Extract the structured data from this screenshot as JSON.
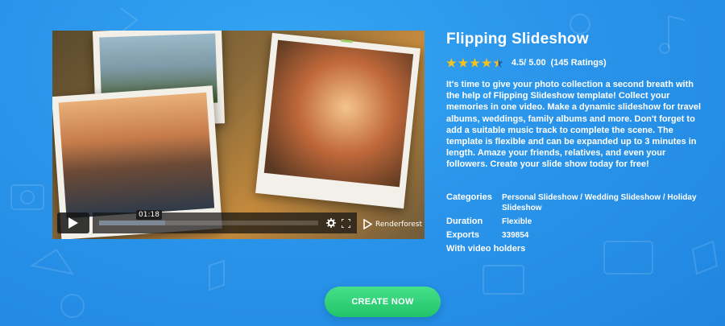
{
  "colors": {
    "accent": "#22c46a",
    "star": "#f7c21b",
    "background": "#2a94ea"
  },
  "player": {
    "current_time": "01:18",
    "progress": 0.3,
    "brand": "Renderforest",
    "icons": [
      "play-icon",
      "settings-icon",
      "fullscreen-icon",
      "renderforest-logo-icon"
    ]
  },
  "template": {
    "title": "Flipping Slideshow",
    "rating": {
      "stars": 4.5,
      "text": "4.5/ 5.00",
      "count": "(145 Ratings)"
    },
    "description": "It's time to give your photo collection a second breath with the help of Flipping Slideshow template! Collect your memories in one video. Make a dynamic slideshow for travel albums, weddings, family albums and more. Don't forget to add a suitable music track to complete the scene. The template is flexible and can be expanded up to 3 minutes in length. Amaze your friends, relatives, and even your followers. Create your slide show today for free!",
    "categories_label": "Categories",
    "categories": "Personal Slideshow / Wedding Slideshow / Holiday Slideshow",
    "duration_label": "Duration",
    "duration": "Flexible",
    "exports_label": "Exports",
    "exports": "339854",
    "video_holders_label": "With video holders"
  },
  "cta": {
    "label": "CREATE NOW"
  }
}
